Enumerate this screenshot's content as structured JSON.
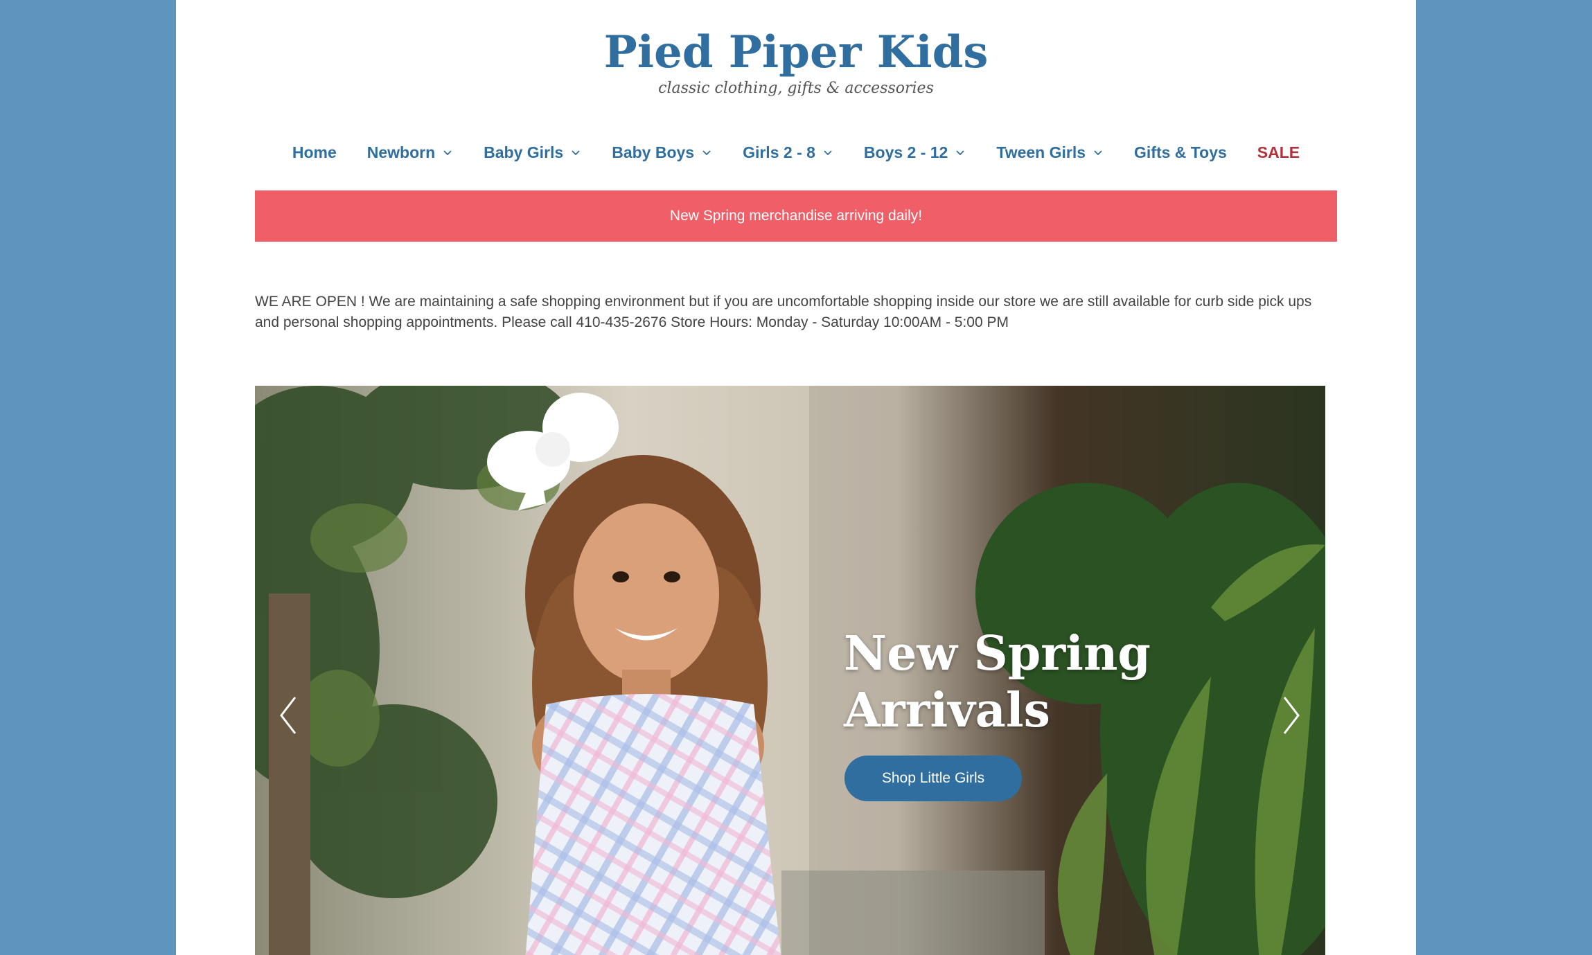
{
  "logo": {
    "title": "Pied Piper Kids",
    "tagline": "classic clothing, gifts & accessories"
  },
  "nav": {
    "items": [
      {
        "label": "Home",
        "dropdown": false
      },
      {
        "label": "Newborn",
        "dropdown": true
      },
      {
        "label": "Baby Girls",
        "dropdown": true
      },
      {
        "label": "Baby Boys",
        "dropdown": true
      },
      {
        "label": "Girls 2 - 8",
        "dropdown": true
      },
      {
        "label": "Boys 2 - 12",
        "dropdown": true
      },
      {
        "label": "Tween Girls",
        "dropdown": true
      },
      {
        "label": "Gifts & Toys",
        "dropdown": false
      },
      {
        "label": "SALE",
        "dropdown": false
      }
    ]
  },
  "banner": {
    "text": "New Spring merchandise arriving daily!"
  },
  "notice": {
    "text": "WE ARE OPEN ! We are maintaining a safe shopping environment but if you are uncomfortable shopping inside our store we are still available for curb side pick ups and personal shopping appointments. Please call 410-435-2676 Store Hours: Monday - Saturday 10:00AM - 5:00 PM"
  },
  "hero": {
    "title": "New Spring Arrivals",
    "button_label": "Shop Little Girls"
  },
  "colors": {
    "page_bg": "#5f94bf",
    "brand_blue": "#2f6e9e",
    "banner_red": "#f05f67",
    "sale_red": "#b0323a"
  },
  "icons": {
    "nav_dropdown": "chevron-down-icon",
    "slider_prev": "chevron-left-icon",
    "slider_next": "chevron-right-icon"
  }
}
